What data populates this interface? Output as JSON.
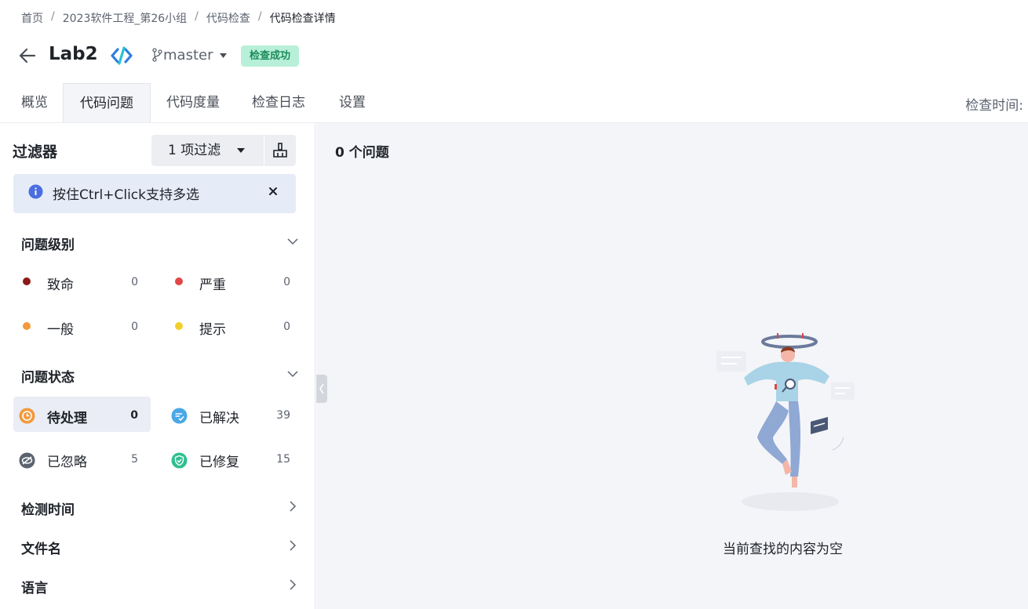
{
  "breadcrumb": [
    "首页",
    "2023软件工程_第26小组",
    "代码检查",
    "代码检查详情"
  ],
  "breadcrumb_separator": "/",
  "header": {
    "title": "Lab2",
    "branch": "master",
    "status": "检查成功"
  },
  "tabs": [
    "概览",
    "代码问题",
    "代码度量",
    "检查日志",
    "设置"
  ],
  "active_tab": "代码问题",
  "check_time_label": "检查时间:",
  "filter": {
    "title": "过滤器",
    "button_label": "1 项过滤",
    "tip": "按住Ctrl+Click支持多选"
  },
  "severity": {
    "title": "问题级别",
    "items": [
      {
        "label": "致命",
        "count": "0",
        "color": "#8b1a1a"
      },
      {
        "label": "严重",
        "count": "0",
        "color": "#e04848"
      },
      {
        "label": "一般",
        "count": "0",
        "color": "#f29a3c"
      },
      {
        "label": "提示",
        "count": "0",
        "color": "#f2cf2c"
      }
    ]
  },
  "status": {
    "title": "问题状态",
    "items": [
      {
        "label": "待处理",
        "count": "0",
        "icon": "clock-icon",
        "color": "#f29a3c"
      },
      {
        "label": "已解决",
        "count": "39",
        "icon": "check-list-icon",
        "color": "#4aa8e8"
      },
      {
        "label": "已忽略",
        "count": "5",
        "icon": "eye-off-icon",
        "color": "#5c6370"
      },
      {
        "label": "已修复",
        "count": "15",
        "icon": "shield-check-icon",
        "color": "#2fbf91"
      }
    ]
  },
  "collapsible_sections": [
    "检测时间",
    "文件名",
    "语言"
  ],
  "main": {
    "issues_count": "0 个问题",
    "empty_text": "当前查找的内容为空"
  }
}
